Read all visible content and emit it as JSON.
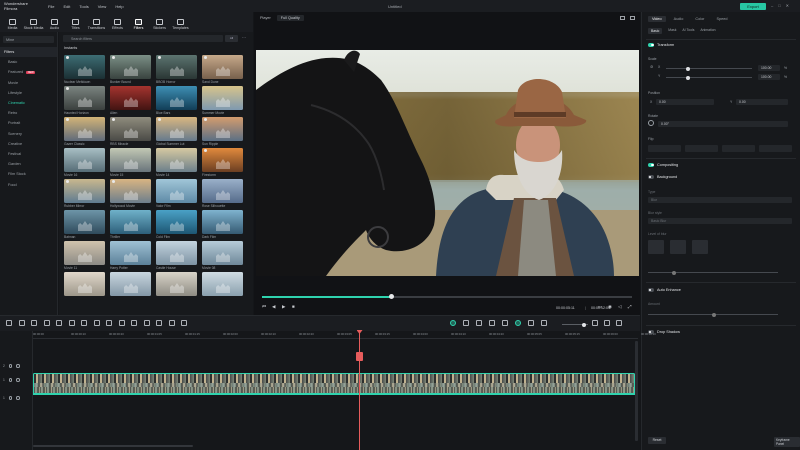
{
  "titlebar": {
    "app_name": "Wondershare Filmora",
    "menus": [
      "File",
      "Edit",
      "Tools",
      "View",
      "Help"
    ],
    "project_name": "Untitled",
    "export_label": "Export"
  },
  "toolbar": {
    "tabs": [
      {
        "label": "Media",
        "icon": "media-icon",
        "active": false
      },
      {
        "label": "Stock Media",
        "icon": "stock-media-icon",
        "active": false
      },
      {
        "label": "Audio",
        "icon": "audio-icon",
        "active": false
      },
      {
        "label": "Titles",
        "icon": "titles-icon",
        "active": false
      },
      {
        "label": "Transitions",
        "icon": "transitions-icon",
        "active": false
      },
      {
        "label": "Effects",
        "icon": "effects-icon",
        "active": false
      },
      {
        "label": "Filters",
        "icon": "filters-icon",
        "active": true
      },
      {
        "label": "Stickers",
        "icon": "stickers-icon",
        "active": false
      },
      {
        "label": "Templates",
        "icon": "templates-icon",
        "active": false
      }
    ]
  },
  "sidebar": {
    "mine_label": "Mine",
    "header": "Filters",
    "items": [
      {
        "label": "Basic",
        "active": false,
        "badge": ""
      },
      {
        "label": "Featured",
        "active": false,
        "badge": "NEW"
      },
      {
        "label": "Movie",
        "active": false,
        "badge": ""
      },
      {
        "label": "Lifestyle",
        "active": false,
        "badge": ""
      },
      {
        "label": "Cinematic",
        "active": true,
        "badge": ""
      },
      {
        "label": "Retro",
        "active": false,
        "badge": ""
      },
      {
        "label": "Portrait",
        "active": false,
        "badge": ""
      },
      {
        "label": "Scenery",
        "active": false,
        "badge": ""
      },
      {
        "label": "Creative",
        "active": false,
        "badge": ""
      },
      {
        "label": "Festival",
        "active": false,
        "badge": ""
      },
      {
        "label": "Garden",
        "active": false,
        "badge": ""
      },
      {
        "label": "Film Stock",
        "active": false,
        "badge": ""
      },
      {
        "label": "Food",
        "active": false,
        "badge": ""
      }
    ]
  },
  "filters": {
    "search_placeholder": "Search filters",
    "toggle_label": "All",
    "section_title": "Instants",
    "tiles": [
      {
        "label": "Nuclear Meltdown",
        "colors": [
          "#3d6d74",
          "#1b2f33"
        ],
        "dl": true
      },
      {
        "label": "Bunker Bound",
        "colors": [
          "#7b8f86",
          "#39433f"
        ],
        "dl": true
      },
      {
        "label": "BBOB Horror",
        "colors": [
          "#5c7470",
          "#2a3634"
        ],
        "dl": true
      },
      {
        "label": "Sand Dune",
        "colors": [
          "#c6a98a",
          "#77604c"
        ],
        "dl": true
      },
      {
        "label": "Haunted Horizon",
        "colors": [
          "#7b8480",
          "#3b403e"
        ],
        "dl": true
      },
      {
        "label": "Alien",
        "colors": [
          "#a5342f",
          "#431412"
        ],
        "dl": false
      },
      {
        "label": "Blue Bars",
        "colors": [
          "#3e8fb4",
          "#123e57"
        ],
        "dl": false
      },
      {
        "label": "Summer Movie",
        "colors": [
          "#d7c48b",
          "#7e99b0"
        ],
        "dl": false
      },
      {
        "label": "Gazer Classic",
        "colors": [
          "#d3b477",
          "#5f6a7a"
        ],
        "dl": true
      },
      {
        "label": "RBS Miracle",
        "colors": [
          "#8f8c7d",
          "#4a4a46"
        ],
        "dl": true
      },
      {
        "label": "Global Summer Lut",
        "colors": [
          "#d9b680",
          "#667a8d"
        ],
        "dl": true
      },
      {
        "label": "Sun Ripple",
        "colors": [
          "#d49c6e",
          "#5b6f84"
        ],
        "dl": true
      },
      {
        "label": "Movie 16",
        "colors": [
          "#a8bfc4",
          "#566c76"
        ],
        "dl": false
      },
      {
        "label": "Movie 15",
        "colors": [
          "#c2c8b4",
          "#69747b"
        ],
        "dl": false
      },
      {
        "label": "Movie 14",
        "colors": [
          "#d6c9a1",
          "#6c7f8b"
        ],
        "dl": false
      },
      {
        "label": "Firestorm",
        "colors": [
          "#e18a3d",
          "#6b3e22"
        ],
        "dl": true
      },
      {
        "label": "Rubber Mirror",
        "colors": [
          "#c9b78e",
          "#5f7b90"
        ],
        "dl": true
      },
      {
        "label": "Hollywood Movie",
        "colors": [
          "#d8b482",
          "#6d7e8c"
        ],
        "dl": true
      },
      {
        "label": "Valor Film",
        "colors": [
          "#a1c6d8",
          "#5e8aa6"
        ],
        "dl": false
      },
      {
        "label": "Rose Silhouette",
        "colors": [
          "#9ab0c9",
          "#556b8a"
        ],
        "dl": false
      },
      {
        "label": "Batman",
        "colors": [
          "#6d95a8",
          "#2f4a5b"
        ],
        "dl": false
      },
      {
        "label": "Thriller",
        "colors": [
          "#6fb1c9",
          "#2d5f7a"
        ],
        "dl": false
      },
      {
        "label": "Cold Film",
        "colors": [
          "#4aa1c6",
          "#1d5673"
        ],
        "dl": false
      },
      {
        "label": "Dark Film",
        "colors": [
          "#7fb3cf",
          "#355a72"
        ],
        "dl": false
      },
      {
        "label": "Movie 11",
        "colors": [
          "#d0c3ad",
          "#8c8a85"
        ],
        "dl": false
      },
      {
        "label": "Harry Potter",
        "colors": [
          "#9fc1d4",
          "#5c8199"
        ],
        "dl": false
      },
      {
        "label": "Castle House",
        "colors": [
          "#c3d3de",
          "#7d93a3"
        ],
        "dl": false
      },
      {
        "label": "Movie 08",
        "colors": [
          "#b6cbd8",
          "#6f8899"
        ],
        "dl": false
      },
      {
        "label": "",
        "colors": [
          "#e1d8cb",
          "#9c9689"
        ],
        "dl": false
      },
      {
        "label": "",
        "colors": [
          "#c9d6df",
          "#8397a6"
        ],
        "dl": false
      },
      {
        "label": "",
        "colors": [
          "#d8d3c8",
          "#8e8b83"
        ],
        "dl": false
      },
      {
        "label": "",
        "colors": [
          "#cfdbe2",
          "#8aa0ae"
        ],
        "dl": false
      }
    ]
  },
  "player": {
    "label": "Player",
    "quality": "Full Quality",
    "current_time": "00:00:05:11",
    "total_time": "00:00:12:09",
    "progress": 0.35
  },
  "properties": {
    "tabs": [
      {
        "label": "Video",
        "active": true
      },
      {
        "label": "Audio",
        "active": false
      },
      {
        "label": "Color",
        "active": false
      },
      {
        "label": "Speed",
        "active": false
      }
    ],
    "subtabs": [
      {
        "label": "Basic",
        "active": true
      },
      {
        "label": "Mask",
        "active": false
      },
      {
        "label": "AI Tools",
        "active": false
      },
      {
        "label": "Animation",
        "active": false
      }
    ],
    "transform_label": "Transform",
    "scale_label": "Scale",
    "scale_x_label": "X",
    "scale_y_label": "Y",
    "scale_x": "100.00",
    "scale_y": "100.00",
    "unit_pct": "%",
    "position_label": "Position",
    "pos_x_label": "X",
    "pos_y_label": "Y",
    "pos_x": "0.00",
    "pos_y": "0.00",
    "pos_unit": "px",
    "rotate_label": "Rotate",
    "rotate_value": "0.00°",
    "flip_label": "Flip",
    "compositing_label": "Compositing",
    "background_label": "Background",
    "bg_type_label": "Type",
    "bg_type_value": "Blur",
    "blur_style_label": "Blur style",
    "blur_style_value": "Basic Blur",
    "blur_level_label": "Level of blur",
    "auto_enhance_label": "Auto Enhance",
    "amount_label": "Amount",
    "drop_shadow_label": "Drop Shadow",
    "reset_label": "Reset",
    "keyframe_label": "Keyframe Panel"
  },
  "timeline": {
    "ruler": [
      "00:00:00",
      "00:00:00:10",
      "00:00:00:20",
      "00:00:01:05",
      "00:00:01:15",
      "00:00:02:00",
      "00:00:02:10",
      "00:00:02:20",
      "00:00:03:05",
      "00:00:03:15",
      "00:00:04:00",
      "00:00:04:10",
      "00:00:04:20",
      "00:00:05:05",
      "00:00:05:15",
      "00:00:06:00",
      "00:00:06:10"
    ],
    "track_labels": [
      "2",
      "1",
      "1"
    ]
  }
}
